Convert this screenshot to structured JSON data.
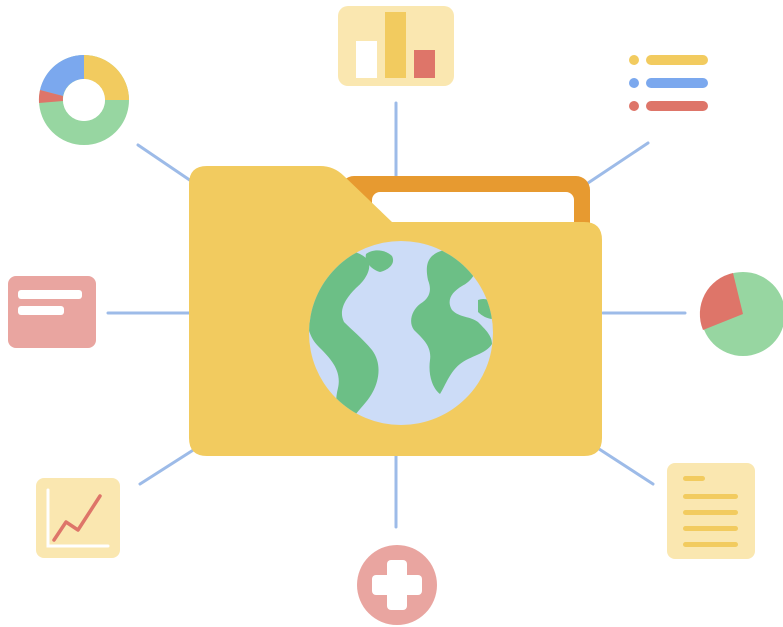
{
  "illustration": {
    "subject": "shared-folder-with-globe",
    "icons": [
      "donut-chart-icon",
      "bar-chart-icon",
      "list-icon",
      "pie-chart-icon",
      "document-icon",
      "medical-cross-icon",
      "line-chart-icon",
      "text-card-icon"
    ]
  },
  "colors": {
    "folder_body": "#F2CB5F",
    "folder_back": "#E79A30",
    "paper": "#FFFFFF",
    "globe_water": "#CCDCF7",
    "globe_land": "#6CBF86",
    "connector": "#9DBBE8",
    "yellow_soft": "#FAE7B0",
    "yellow": "#F2CB5F",
    "red": "#DE7569",
    "red_soft": "#E9A5A0",
    "blue": "#7BA8EE",
    "green": "#97D6A1"
  }
}
